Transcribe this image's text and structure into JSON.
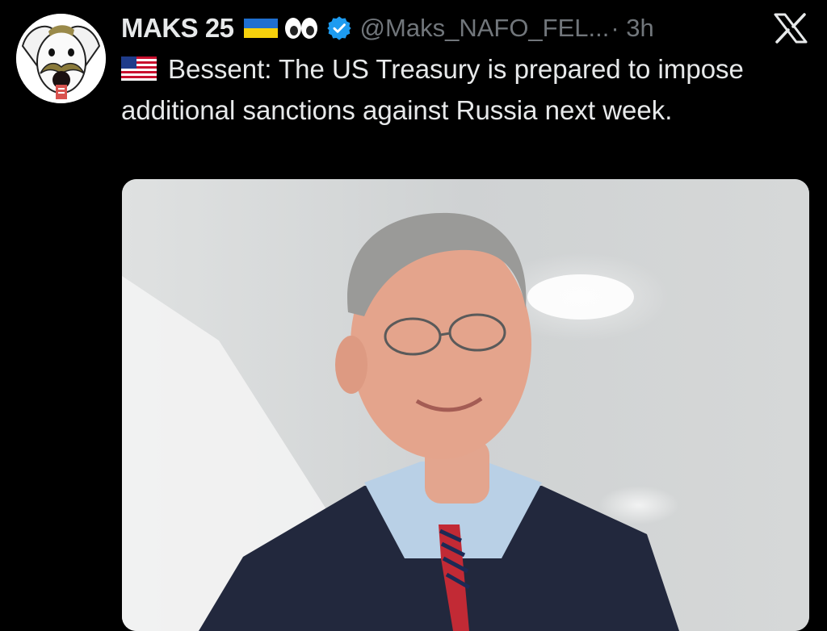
{
  "tweet": {
    "display_name": "MAKS 25",
    "name_emojis": [
      "ukraine-flag-emoji",
      "eyes-emoji"
    ],
    "verified_badge": "verified-badge-icon",
    "handle": "@Maks_NAFO_FEL...",
    "separator_time": "· 3h",
    "text_flag": "us-flag-emoji",
    "text": "Bessent: The US Treasury is prepared to impose additional sanctions against Russia next week."
  },
  "icons": {
    "x_logo": "x-logo-icon",
    "avatar": "avatar"
  },
  "colors": {
    "background": "#000000",
    "text": "#e7e9ea",
    "muted": "#71767b",
    "verified": "#1d9bf0"
  },
  "media": {
    "description_icon": "photo-of-man-in-suit"
  }
}
